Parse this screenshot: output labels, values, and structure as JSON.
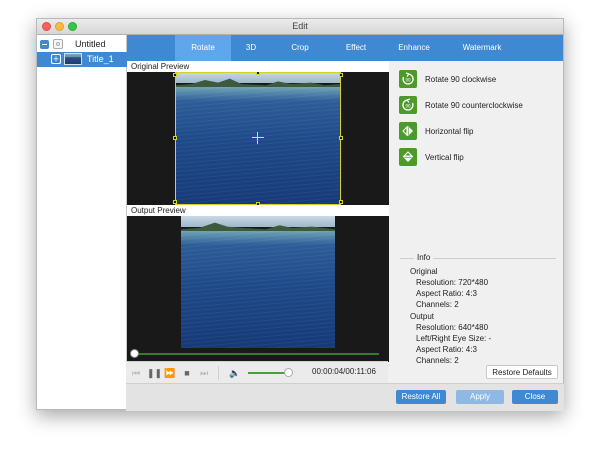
{
  "window": {
    "title": "Edit"
  },
  "sidebar": {
    "items": [
      {
        "label": "Untitled"
      },
      {
        "label": "Title_1"
      }
    ]
  },
  "tabs": [
    {
      "label": "Rotate",
      "active": true
    },
    {
      "label": "3D",
      "active": false
    },
    {
      "label": "Crop",
      "active": false
    },
    {
      "label": "Effect",
      "active": false
    },
    {
      "label": "Enhance",
      "active": false
    },
    {
      "label": "Watermark",
      "active": false
    }
  ],
  "preview": {
    "original_label": "Original Preview",
    "output_label": "Output Preview"
  },
  "playback": {
    "timecode": "00:00:04/00:11:06",
    "progress_fraction": 0.0,
    "volume_fraction": 0.8
  },
  "rotate_actions": [
    {
      "label": "Rotate 90 clockwise",
      "icon": "rotate-clockwise-icon"
    },
    {
      "label": "Rotate 90 counterclockwise",
      "icon": "rotate-counterclockwise-icon"
    },
    {
      "label": "Horizontal flip",
      "icon": "horizontal-flip-icon"
    },
    {
      "label": "Vertical flip",
      "icon": "vertical-flip-icon"
    }
  ],
  "info": {
    "title": "Info",
    "original_heading": "Original",
    "original_resolution": "Resolution: 720*480",
    "original_aspect": "Aspect Ratio: 4:3",
    "original_channels": "Channels: 2",
    "output_heading": "Output",
    "output_resolution": "Resolution: 640*480",
    "output_eye_size": "Left/Right Eye Size: -",
    "output_aspect": "Aspect Ratio: 4:3",
    "output_channels": "Channels: 2"
  },
  "buttons": {
    "restore_defaults": "Restore Defaults",
    "restore_all": "Restore All",
    "apply": "Apply",
    "close": "Close"
  },
  "colors": {
    "accent_blue": "#3f89d2",
    "active_tab": "#5fa7ea",
    "action_green": "#4c9a2a",
    "crop_yellow": "#d8d02a"
  }
}
